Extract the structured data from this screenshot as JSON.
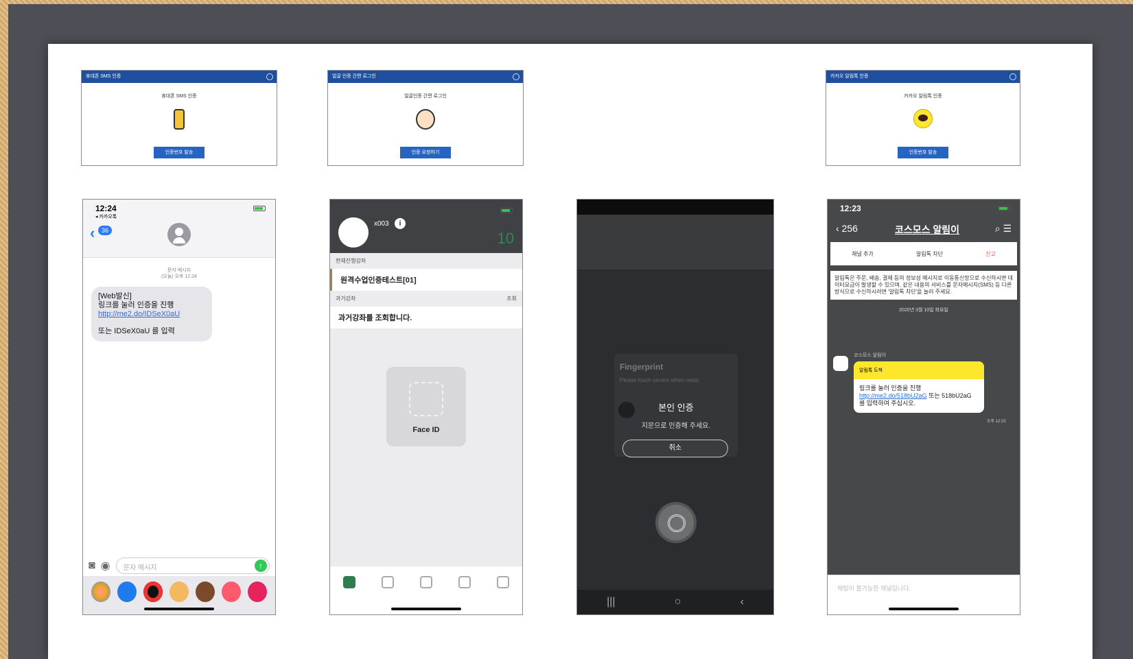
{
  "cards": [
    {
      "bar": "휴대폰 SMS 인증",
      "title": "휴대폰 SMS 인증",
      "button": "인증번호 발송"
    },
    {
      "bar": "얼굴 인증 간편 로그인",
      "title": "얼굴인증 간편 로그인",
      "button": "인증 요청하기"
    },
    {
      "bar": "카카오 알림톡 인증",
      "title": "카카오 알림톡 인증",
      "button": "인증번호 발송"
    }
  ],
  "phone1": {
    "time": "12:24",
    "carrier": "◂ 카카오톡",
    "badge": "36",
    "meta1": "문자 메시지",
    "meta2": "(오늘) 오후 12:24",
    "msg_line1": "[Web발신]",
    "msg_line2": "링크를 눌러 인증을 진행 ",
    "msg_link": "http://me2.do/IDSeX0aU",
    "msg_line3": "또는 IDSeX0aU 를 입력",
    "input_placeholder": "문자 메시지"
  },
  "phone2": {
    "user": "x003",
    "number": "10",
    "section1": "현재진행강좌",
    "course": "원격수업인증테스트[01]",
    "section2": "과거강좌",
    "section2_action": "조회",
    "past": "과거강좌를 조회합니다.",
    "faceid": "Face ID"
  },
  "phone3": {
    "dialog_title": "Fingerprint",
    "dialog_hint": "Please touch sensor when ready",
    "auth_title": "본인 인증",
    "auth_desc": "지문으로 인증해 주세요.",
    "cancel": "취소",
    "nav": [
      "|||",
      "○",
      "‹"
    ]
  },
  "phone4": {
    "time": "12:23",
    "back": "‹ 256",
    "title": "코스모스 알림이",
    "tool1": "채널 추가",
    "tool2": "알림톡 차단",
    "tool3": "신고",
    "notice": "알림톡은 주문, 배송, 결제 등의 정보성 메시지로 이동통신망으로 수신하시면 데이터요금이 발생할 수 있으며, 같은 내용의 서비스를 문자메시지(SMS) 등 다른 방식으로 수신하시려면 '알림톡 차단'을 눌러 주세요.",
    "date": "2020년 3월 10일 화요일",
    "sender": "코스모스 알림이",
    "bubble_head": "알림톡 도착",
    "bubble_text": "링크를 눌러 인증을 진행 ",
    "bubble_link": "http://me2.do/518bU2aG",
    "bubble_tail": " 또는 518bU2aG 를 입력하여 주십시오.",
    "msg_time": "오후 12:23",
    "input_placeholder": "채팅이 불가능한 채널입니다."
  },
  "colors": {
    "bar": "#1f4f9e",
    "button": "#2764c2",
    "kakao": "#fde72d",
    "green": "#2e7d4f"
  }
}
